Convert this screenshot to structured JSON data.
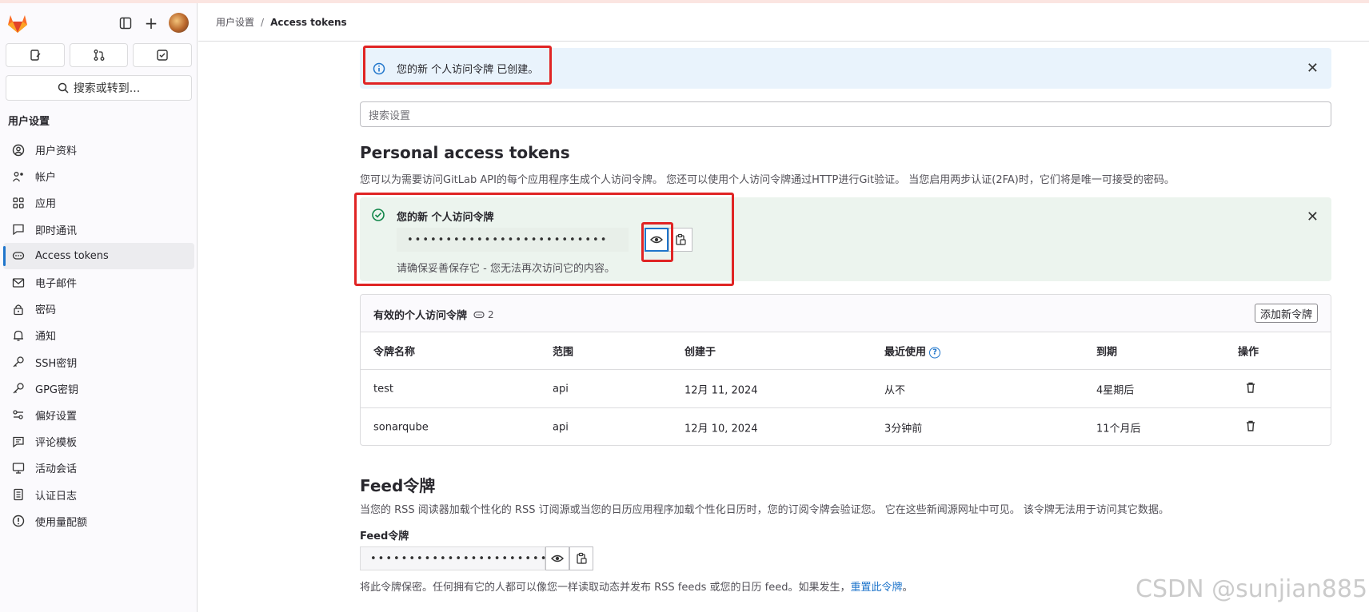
{
  "breadcrumb": {
    "parent": "用户设置",
    "separator": "/",
    "current": "Access tokens"
  },
  "sidebar": {
    "search_label": "搜索或转到...",
    "section_title": "用户设置",
    "items": [
      {
        "label": "用户资料",
        "icon": "user-profile-icon"
      },
      {
        "label": "帐户",
        "icon": "account-icon"
      },
      {
        "label": "应用",
        "icon": "applications-icon"
      },
      {
        "label": "即时通讯",
        "icon": "chat-icon"
      },
      {
        "label": "Access tokens",
        "icon": "token-icon",
        "active": true
      },
      {
        "label": "电子邮件",
        "icon": "mail-icon"
      },
      {
        "label": "密码",
        "icon": "lock-icon"
      },
      {
        "label": "通知",
        "icon": "bell-icon"
      },
      {
        "label": "SSH密钥",
        "icon": "key-icon"
      },
      {
        "label": "GPG密钥",
        "icon": "key-icon"
      },
      {
        "label": "偏好设置",
        "icon": "preferences-icon"
      },
      {
        "label": "评论模板",
        "icon": "comment-icon"
      },
      {
        "label": "活动会话",
        "icon": "monitor-icon"
      },
      {
        "label": "认证日志",
        "icon": "log-icon"
      },
      {
        "label": "使用量配额",
        "icon": "quota-icon"
      }
    ]
  },
  "info_alert": {
    "text": "您的新 个人访问令牌 已创建。"
  },
  "search_settings": {
    "placeholder": "搜索设置"
  },
  "pat": {
    "title": "Personal access tokens",
    "description": "您可以为需要访问GitLab API的每个应用程序生成个人访问令牌。 您还可以使用个人访问令牌通过HTTP进行Git验证。 当您启用两步认证(2FA)时，它们将是唯一可接受的密码。",
    "new_token_title": "您的新 个人访问令牌",
    "masked_value": "••••••••••••••••••••••••••",
    "save_note": "请确保妥善保存它 - 您无法再次访问它的内容。"
  },
  "active_tokens": {
    "title": "有效的个人访问令牌",
    "count": "2",
    "add_button": "添加新令牌",
    "columns": [
      "令牌名称",
      "范围",
      "创建于",
      "最近使用",
      "到期",
      "操作"
    ],
    "rows": [
      {
        "name": "test",
        "scope": "api",
        "created": "12月 11, 2024",
        "last_used": "从不",
        "expires": "4星期后"
      },
      {
        "name": "sonarqube",
        "scope": "api",
        "created": "12月 10, 2024",
        "last_used": "3分钟前",
        "expires": "11个月后"
      }
    ]
  },
  "feed": {
    "title": "Feed令牌",
    "description": "当您的 RSS 阅读器加载个性化的 RSS 订阅源或当您的日历应用程序加载个性化日历时，您的订阅令牌会验证您。 它在这些新闻源网址中可见。 该令牌无法用于访问其它数据。",
    "label": "Feed令牌",
    "masked_value": "••••••••••••••••••••••••••",
    "note": "将此令牌保密。任何拥有它的人都可以像您一样读取动态并发布 RSS feeds 或您的日历 feed。如果发生，",
    "reset_link": "重置此令牌",
    "note_end": "。"
  },
  "watermark": "CSDN @sunjian885"
}
